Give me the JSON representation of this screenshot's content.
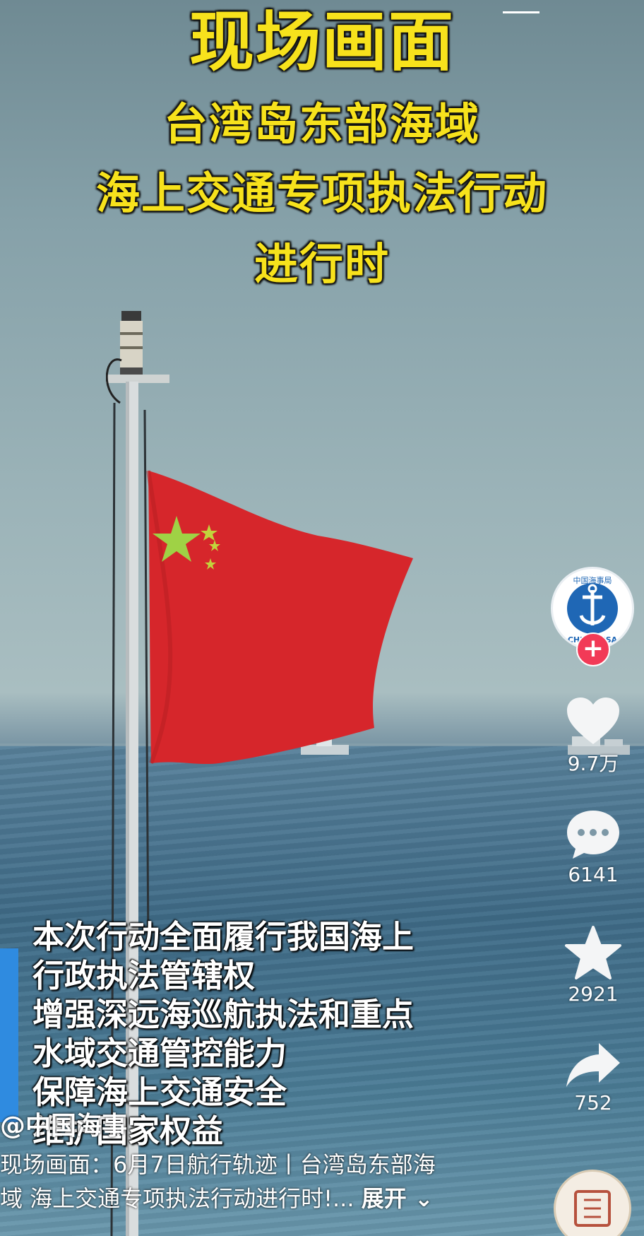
{
  "overlay_title": {
    "line1": "现场画面",
    "line2": "台湾岛东部海域",
    "line3": "海上交通专项执法行动",
    "line4": "进行时"
  },
  "caption": {
    "lines": [
      "本次行动全面履行我国海上",
      "行政执法管辖权",
      "增强深远海巡航执法和重点",
      "水域交通管控能力",
      "保障海上交通安全",
      "维护国家权益"
    ]
  },
  "author": "@中国海事",
  "description": {
    "line1": "现场画面：6月7日航行轨迹丨台湾岛东部海",
    "line2": "域 海上交通专项执法行动进行时!...",
    "expand": "展开"
  },
  "sidebar": {
    "avatar_text": "中国海事局",
    "avatar_abbr": "CHINA MSA",
    "follow": "+",
    "likes": "9.7万",
    "comments": "6141",
    "favorites": "2921",
    "shares": "752"
  },
  "colors": {
    "title_yellow": "#f7e21c",
    "follow_red": "#f23a57",
    "flag_red": "#d6262b",
    "star_yellow": "#f2e53a"
  }
}
